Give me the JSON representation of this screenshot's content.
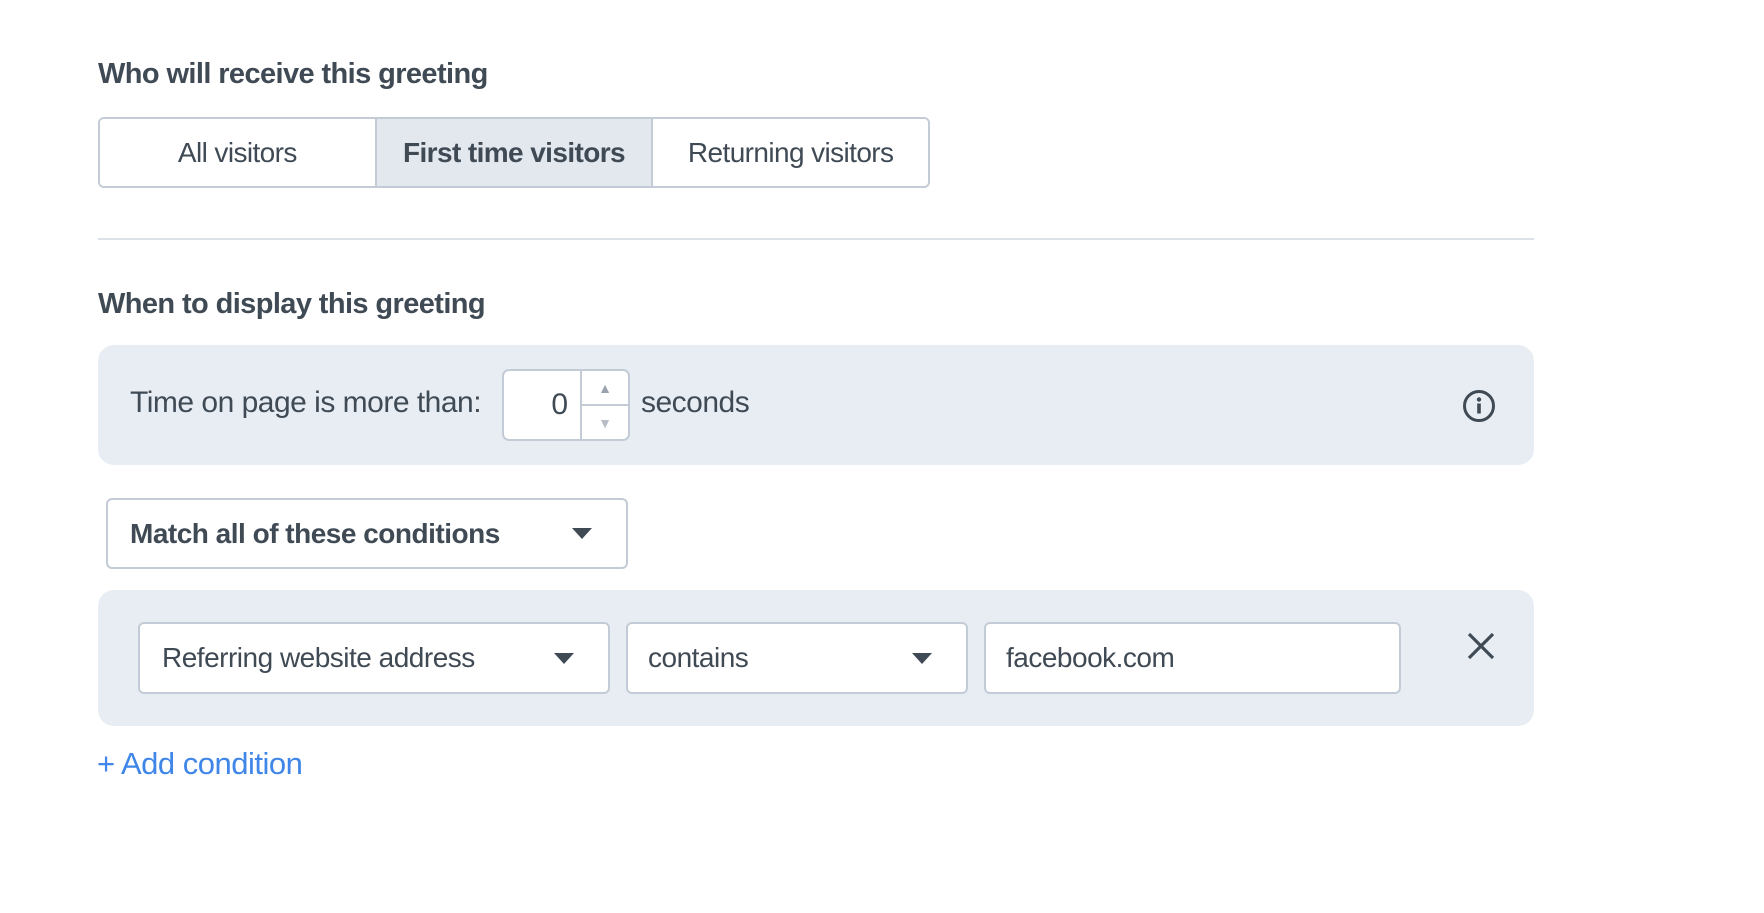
{
  "audience": {
    "heading": "Who will receive this greeting",
    "options": [
      {
        "label": "All visitors",
        "selected": false
      },
      {
        "label": "First time visitors",
        "selected": true
      },
      {
        "label": "Returning visitors",
        "selected": false
      }
    ]
  },
  "display": {
    "heading": "When to display this greeting",
    "time_on_page": {
      "label": "Time on page is more than:",
      "value": "0",
      "unit": "seconds",
      "info_icon": "info-circle-icon"
    },
    "match_select": {
      "value": "Match all of these conditions",
      "icon": "caret-down-icon"
    },
    "conditions": [
      {
        "field": "Referring website address",
        "operator": "contains",
        "value": "facebook.com",
        "remove_icon": "close-icon"
      }
    ],
    "add_condition_label": "+ Add condition"
  },
  "colors": {
    "text": "#3f4a55",
    "panel_bg": "#e8edf4",
    "border": "#c3ccd6",
    "selected_bg": "#e3e8ef",
    "link": "#3f86e8"
  }
}
